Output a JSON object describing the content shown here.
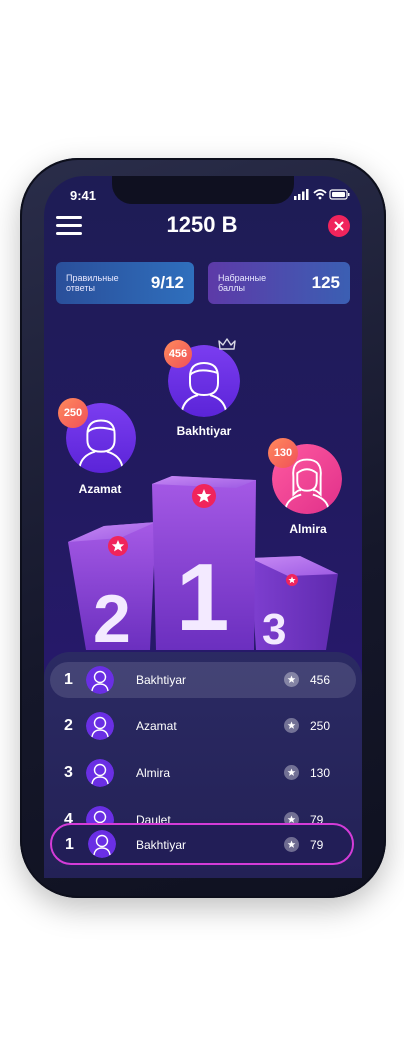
{
  "status": {
    "time": "9:41"
  },
  "header": {
    "title": "1250 B"
  },
  "stats": [
    {
      "label": "Правильные\nответы",
      "value": "9/12"
    },
    {
      "label": "Набранные\nбаллы",
      "value": "125"
    }
  ],
  "podium": {
    "first": {
      "name": "Bakhtiyar",
      "score": "456",
      "digit": "1"
    },
    "second": {
      "name": "Azamat",
      "score": "250",
      "digit": "2"
    },
    "third": {
      "name": "Almira",
      "score": "130",
      "digit": "3"
    }
  },
  "leaderboard": [
    {
      "rank": "1",
      "name": "Bakhtiyar",
      "score": "456"
    },
    {
      "rank": "2",
      "name": "Azamat",
      "score": "250"
    },
    {
      "rank": "3",
      "name": "Almira",
      "score": "130"
    },
    {
      "rank": "4",
      "name": "Daulet",
      "score": "79"
    }
  ],
  "current_user": {
    "rank": "1",
    "name": "Bakhtiyar",
    "score": "79"
  },
  "colors": {
    "accent_red": "#f0245c",
    "highlight_border": "#d43cd8",
    "score_bubble": "#f0505a"
  }
}
